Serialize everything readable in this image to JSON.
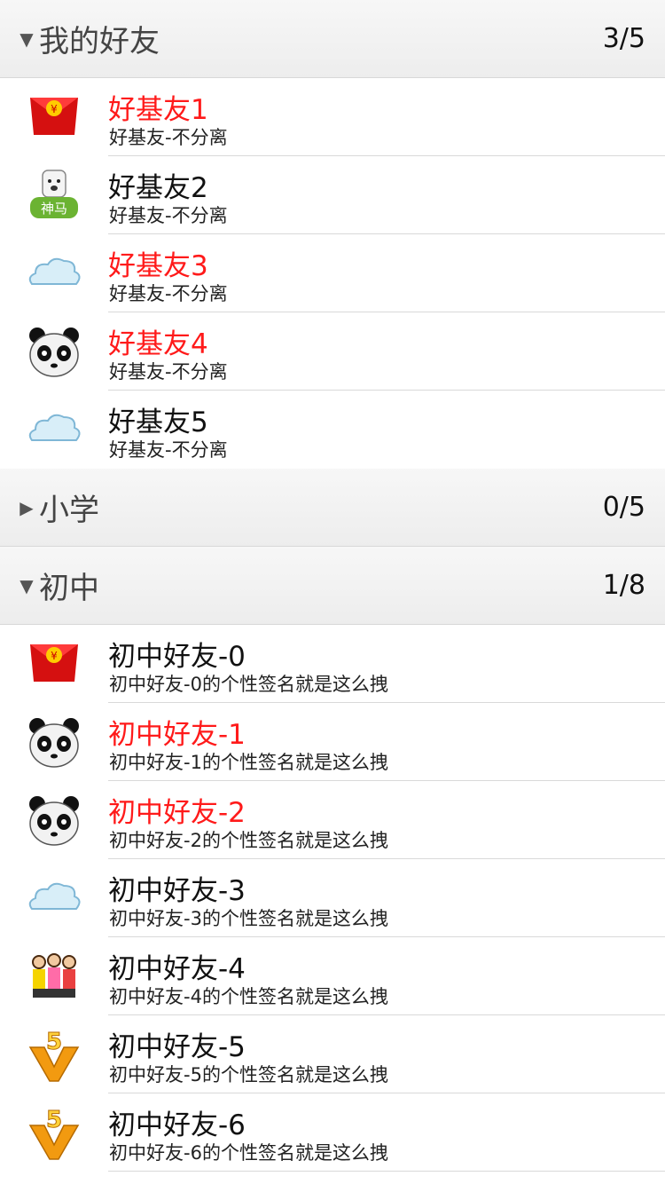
{
  "groups": [
    {
      "name": "我的好友",
      "count": "3/5",
      "expanded": true,
      "friends": [
        {
          "name": "好基友1",
          "signature": "好基友-不分离",
          "online": true,
          "icon": "red-envelope-icon"
        },
        {
          "name": "好基友2",
          "signature": "好基友-不分离",
          "online": false,
          "icon": "alpaca-shenma-icon"
        },
        {
          "name": "好基友3",
          "signature": "好基友-不分离",
          "online": true,
          "icon": "cloud-icon"
        },
        {
          "name": "好基友4",
          "signature": "好基友-不分离",
          "online": true,
          "icon": "panda-icon"
        },
        {
          "name": "好基友5",
          "signature": "好基友-不分离",
          "online": false,
          "icon": "cloud-icon"
        }
      ]
    },
    {
      "name": "小学",
      "count": "0/5",
      "expanded": false,
      "friends": []
    },
    {
      "name": "初中",
      "count": "1/8",
      "expanded": true,
      "friends": [
        {
          "name": "初中好友-0",
          "signature": "初中好友-0的个性签名就是这么拽",
          "online": false,
          "icon": "red-envelope-icon"
        },
        {
          "name": "初中好友-1",
          "signature": "初中好友-1的个性签名就是这么拽",
          "online": true,
          "icon": "panda-icon"
        },
        {
          "name": "初中好友-2",
          "signature": "初中好友-2的个性签名就是这么拽",
          "online": true,
          "icon": "panda-icon"
        },
        {
          "name": "初中好友-3",
          "signature": "初中好友-3的个性签名就是这么拽",
          "online": false,
          "icon": "cloud-icon"
        },
        {
          "name": "初中好友-4",
          "signature": "初中好友-4的个性签名就是这么拽",
          "online": false,
          "icon": "group-people-icon"
        },
        {
          "name": "初中好友-5",
          "signature": "初中好友-5的个性签名就是这么拽",
          "online": false,
          "icon": "vip-5-icon"
        },
        {
          "name": "初中好友-6",
          "signature": "初中好友-6的个性签名就是这么拽",
          "online": false,
          "icon": "vip-5-icon"
        }
      ]
    }
  ],
  "colors": {
    "online_name": "#ff1a1a",
    "offline_name": "#111111",
    "header_bg": "#f2f2f2"
  }
}
